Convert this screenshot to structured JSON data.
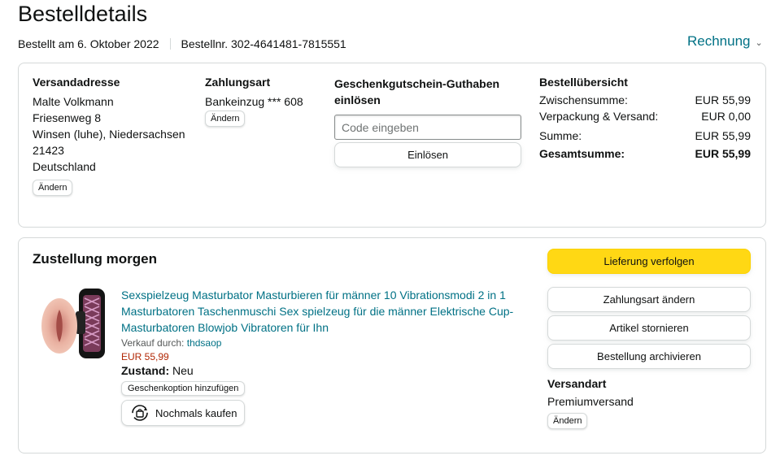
{
  "header": {
    "title": "Bestelldetails",
    "order_date": "Bestellt am 6. Oktober 2022",
    "order_number": "Bestellnr. 302-4641481-7815551",
    "invoice_label": "Rechnung"
  },
  "shipping_address": {
    "heading": "Versandadresse",
    "lines": [
      "Malte Volkmann",
      "Friesenweg 8",
      "Winsen (luhe), Niedersachsen",
      "21423",
      "Deutschland"
    ],
    "change_label": "Ändern"
  },
  "payment": {
    "heading": "Zahlungsart",
    "method": "Bankeinzug *** 608",
    "change_label": "Ändern"
  },
  "gift_card": {
    "heading_line1": "Geschenkgutschein-Guthaben",
    "heading_line2": "einlösen",
    "placeholder": "Code eingeben",
    "redeem_label": "Einlösen"
  },
  "summary": {
    "heading": "Bestellübersicht",
    "rows": [
      {
        "label": "Zwischensumme:",
        "value": "EUR 55,99"
      },
      {
        "label": "Verpackung & Versand:",
        "value": "EUR 0,00"
      },
      {
        "label": "Summe:",
        "value": "EUR 55,99"
      },
      {
        "label": "Gesamtsumme:",
        "value": "EUR 55,99"
      }
    ]
  },
  "delivery": {
    "heading": "Zustellung morgen",
    "product": {
      "title": "Sexspielzeug Masturbator Masturbieren für männer 10 Vibrationsmodi 2 in 1 Masturbatoren Taschenmuschi Sex spielzeug für die männer Elektrische Cup-Masturbatoren Blowjob Vibratoren für Ihn",
      "seller_label": "Verkauf durch:",
      "seller": "thdsaop",
      "price": "EUR 55,99",
      "condition_label": "Zustand:",
      "condition": "Neu",
      "gift_option_label": "Geschenkoption hinzufügen",
      "buy_again_label": "Nochmals kaufen"
    },
    "actions": {
      "track": "Lieferung verfolgen",
      "change_payment": "Zahlungsart ändern",
      "cancel": "Artikel stornieren",
      "archive": "Bestellung archivieren"
    },
    "shipping_type": {
      "heading": "Versandart",
      "value": "Premiumversand",
      "change_label": "Ändern"
    }
  },
  "colors": {
    "link": "#007185",
    "price": "#b12704",
    "accent_button": "#ffd814",
    "border": "#d5d9d9"
  },
  "icons": {
    "invoice_dropdown": "chevron-down-icon",
    "buy_again": "repeat-bag-icon"
  }
}
